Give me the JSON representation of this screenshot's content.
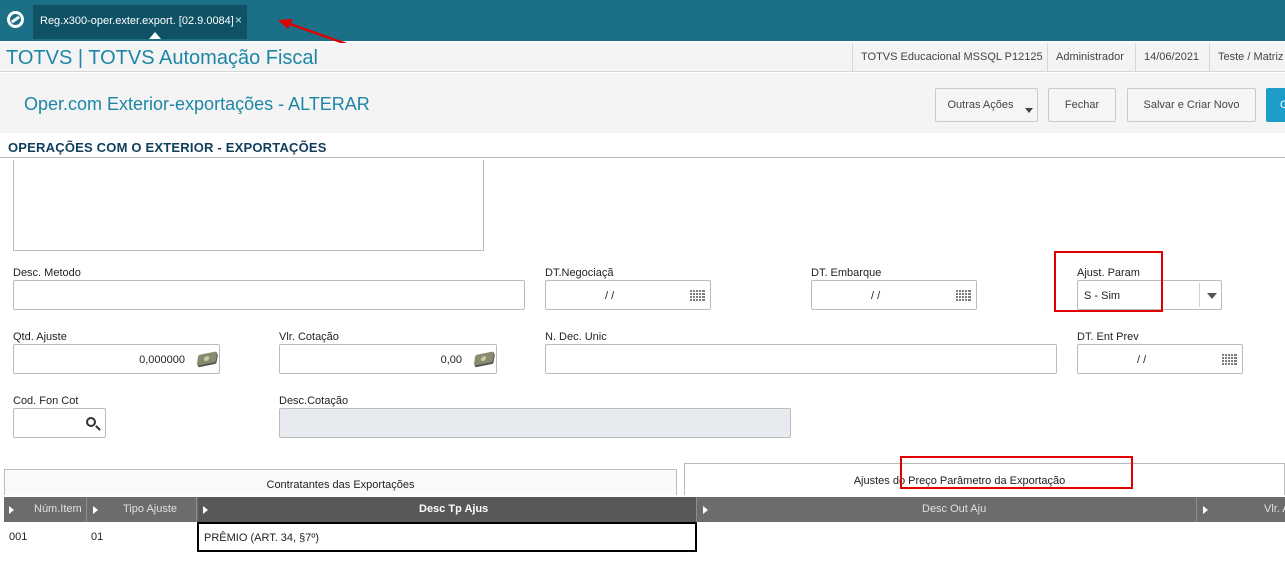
{
  "topbar": {
    "logo_icon": "totvs-logo-icon",
    "tab": {
      "label": "Reg.x300-oper.exter.export. [02.9.0084]",
      "close": "×"
    },
    "background": "#1b6f86"
  },
  "appbar": {
    "title": "TOTVS | TOTVS Automação Fiscal",
    "environment": "TOTVS Educacional MSSQL P12125",
    "user": "Administrador",
    "date": "14/06/2021",
    "branch": "Teste / Matriz"
  },
  "header": {
    "heading": "Oper.com Exterior-exportações - ALTERAR",
    "buttons": {
      "more_actions": "Outras Ações",
      "close": "Fechar",
      "save_new": "Salvar e Criar Novo",
      "confirm": "C"
    }
  },
  "section": {
    "title": "OPERAÇÕES COM O EXTERIOR - EXPORTAÇÕES"
  },
  "form": {
    "desc_metodo": {
      "label": "Desc. Metodo",
      "value": ""
    },
    "dt_negociacao": {
      "label": "DT.Negociaçã",
      "value": "/ /"
    },
    "dt_embarque": {
      "label": "DT. Embarque",
      "value": "/ /"
    },
    "ajust_param": {
      "label": "Ajust. Param",
      "value": "S - Sim"
    },
    "qtd_ajuste": {
      "label": "Qtd. Ajuste",
      "value": "0,000000"
    },
    "vlr_cotacao": {
      "label": "Vlr. Cotação",
      "value": "0,00"
    },
    "n_dec_unic": {
      "label": "N. Dec. Unic",
      "value": ""
    },
    "dt_ent_prev": {
      "label": "DT. Ent Prev",
      "value": "/ /"
    },
    "cod_fon_cot": {
      "label": "Cod. Fon Cot",
      "value": ""
    },
    "desc_cotacao": {
      "label": "Desc.Cotação",
      "value": ""
    }
  },
  "folders": {
    "contratantes": "Contratantes das Exportações",
    "ajustes": "Ajustes do Preço Parâmetro da Exportação"
  },
  "grid": {
    "columns": [
      "Núm.Item",
      "Tipo Ajuste",
      "Desc Tp Ajus",
      "Desc Out Aju",
      "Vlr. A"
    ],
    "rows": [
      {
        "num_item": "001",
        "tipo_ajuste": "01",
        "desc_tp_ajus": "PRÊMIO (ART. 34, §7º)",
        "desc_out_aju": "",
        "vlr": ""
      }
    ]
  },
  "colors": {
    "accent": "#1d86a6",
    "highlight": "#e00000",
    "grid_header": "#6c6c6c"
  }
}
